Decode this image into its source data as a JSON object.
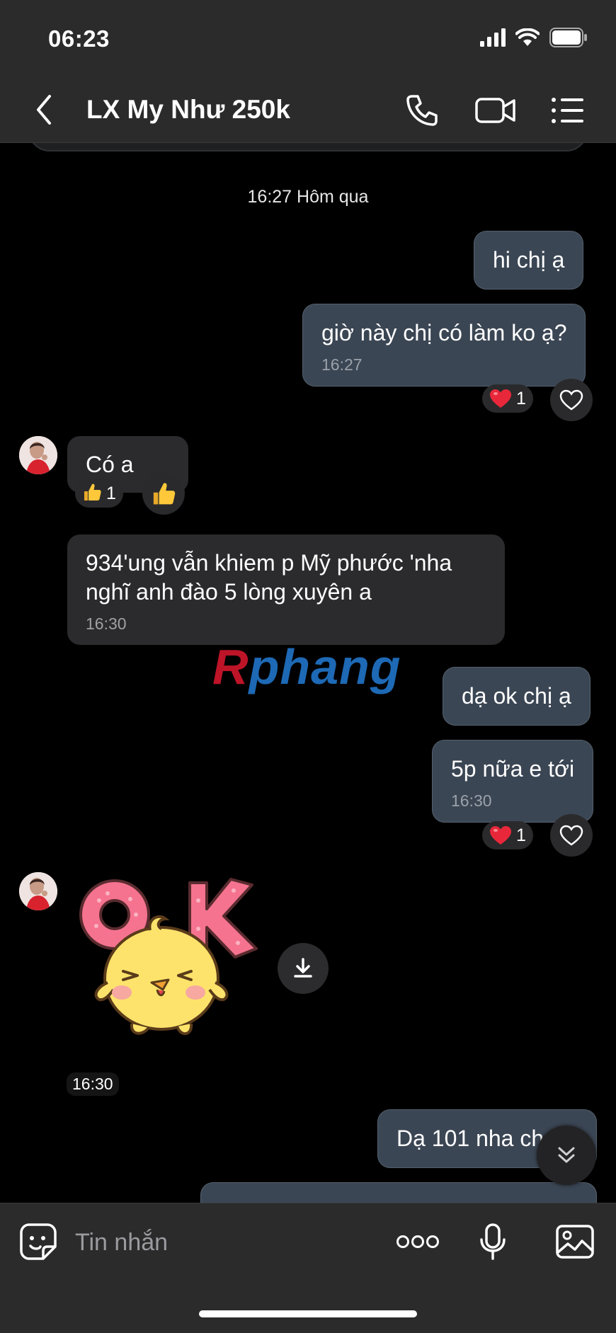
{
  "status_bar": {
    "time": "06:23"
  },
  "header": {
    "title": "LX My Như 250k"
  },
  "chat": {
    "date_separator": "16:27 Hôm qua",
    "messages": [
      {
        "id": "m1",
        "direction": "out",
        "text": "hi chị ạ"
      },
      {
        "id": "m2",
        "direction": "out",
        "text": "giờ này chị có làm ko ạ?",
        "time": "16:27",
        "reaction": {
          "emoji": "heart",
          "count": "1"
        }
      },
      {
        "id": "m3",
        "direction": "in",
        "text": "Có a",
        "reaction": {
          "emoji": "thumbs-up",
          "count": "1"
        }
      },
      {
        "id": "m4",
        "direction": "in",
        "text": "934'ung vẫn khiem p Mỹ phước 'nha nghĩ anh đào 5 lòng xuyên a",
        "time": "16:30"
      },
      {
        "id": "m5",
        "direction": "out",
        "text": "dạ ok chị ạ"
      },
      {
        "id": "m6",
        "direction": "out",
        "text": "5p nữa e tới",
        "time": "16:30",
        "reaction": {
          "emoji": "heart",
          "count": "1"
        }
      },
      {
        "id": "m7",
        "direction": "in",
        "type": "sticker",
        "sticker_text": "OK",
        "time": "16:30"
      },
      {
        "id": "m8",
        "direction": "out",
        "text": "Dạ 101 nha ch"
      }
    ]
  },
  "watermark": {
    "part1": "R",
    "part2": "phang"
  },
  "input": {
    "placeholder": "Tin nhắn"
  },
  "colors": {
    "bar_bg": "#2b2b2c",
    "out_bubble": "#3b4654",
    "in_bubble": "#2b2b2d",
    "heart": "#e8283a"
  }
}
